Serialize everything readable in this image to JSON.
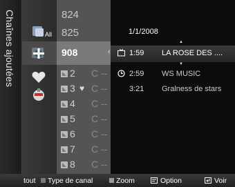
{
  "panel": {
    "title": "Chaînes ajoutées"
  },
  "categories": [
    {
      "icon": "all-channels-icon",
      "label": "All"
    },
    {
      "icon": "add-channel-icon"
    },
    {
      "icon": "favorite-heart-icon"
    },
    {
      "icon": "reserved-channel-icon"
    }
  ],
  "channels": {
    "top": [
      "824",
      "825"
    ],
    "selected": "908",
    "rows": [
      {
        "n": "2",
        "name": "C --",
        "fav": false
      },
      {
        "n": "3",
        "name": "C --",
        "fav": true
      },
      {
        "n": "4",
        "name": "C --",
        "fav": false
      },
      {
        "n": "5",
        "name": "C --",
        "fav": false
      },
      {
        "n": "6",
        "name": "C --",
        "fav": false
      },
      {
        "n": "7",
        "name": "C --",
        "fav": false
      },
      {
        "n": "8",
        "name": "C --",
        "fav": false
      }
    ]
  },
  "programs": {
    "date": "1/1/2008",
    "items": [
      {
        "time": "1:59",
        "title": "LA ROSE DES ....",
        "icon": "tv-icon"
      },
      {
        "time": "2:59",
        "title": "WS MUSIC",
        "icon": "clock-icon"
      },
      {
        "time": "3:21",
        "title": "Gralness de stars",
        "icon": ""
      }
    ]
  },
  "help": {
    "all_label": "tout",
    "type_label": "Type de canal",
    "zoom_label": "Zoom",
    "option_label": "Option",
    "view_label": "Voir",
    "type_color": "#7a7a7a",
    "zoom_color": "#9a9a9a"
  }
}
